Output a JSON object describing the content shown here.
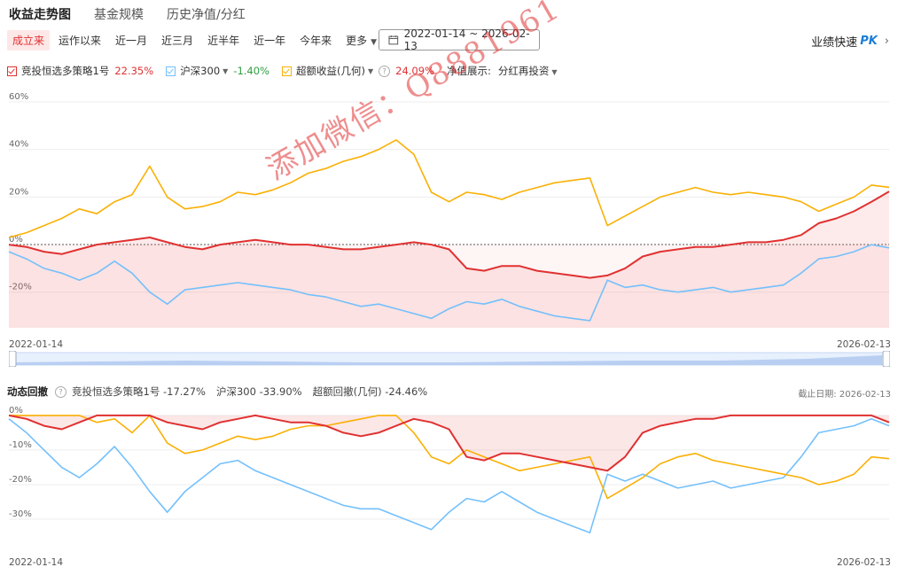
{
  "tabs": [
    "收益走势图",
    "基金规模",
    "历史净值/分红"
  ],
  "periods": [
    "成立来",
    "运作以来",
    "近一月",
    "近三月",
    "近半年",
    "近一年",
    "今年来"
  ],
  "more_label": "更多",
  "date_range": "2022-01-14 ~ 2026-02-13",
  "pk_label": "业绩快速",
  "pk_badge": "PK",
  "legend": {
    "fund": {
      "name": "竞投恒选多策略1号",
      "value": "22.35%"
    },
    "index": {
      "name": "沪深300",
      "value": "-1.40%"
    },
    "excess": {
      "name": "超额收益(几何)",
      "value": "24.09%"
    },
    "nav_label": "净值展示:",
    "nav_mode": "分红再投资"
  },
  "watermark": "添加微信：Q8881961",
  "drawdown_header": {
    "title": "动态回撤",
    "fund": "竞投恒选多策略1号",
    "fund_value": "-17.27%",
    "index": "沪深300",
    "index_value": "-33.90%",
    "excess": "超额回撤(几何)",
    "excess_value": "-24.46%",
    "as_of_label": "截止日期:",
    "as_of": "2026-02-13"
  },
  "colors": {
    "fund": "#e03131",
    "index": "#74c0fc",
    "excess": "#fab005",
    "active": "#e03131"
  },
  "chart_data": [
    {
      "type": "line",
      "x_start": "2022-01-14",
      "x_end": "2026-02-13",
      "ylim": [
        -35,
        60
      ],
      "y_ticks": [
        "60%",
        "40%",
        "20%",
        "0%",
        "-20%"
      ],
      "y_tick_values": [
        60,
        40,
        20,
        0,
        -20
      ],
      "x": [
        0,
        2,
        4,
        6,
        8,
        10,
        12,
        14,
        16,
        18,
        20,
        22,
        24,
        26,
        28,
        30,
        32,
        34,
        36,
        38,
        40,
        42,
        44,
        46,
        48,
        50,
        52,
        54,
        56,
        58,
        60,
        62,
        64,
        66,
        68,
        70,
        72,
        74,
        76,
        78,
        80,
        82,
        84,
        86,
        88,
        90,
        92,
        94,
        96,
        98,
        100
      ],
      "series": [
        {
          "name": "竞投恒选多策略1号",
          "values": [
            0,
            -1,
            -3,
            -4,
            -2,
            0,
            1,
            2,
            3,
            1,
            -1,
            -2,
            0,
            1,
            2,
            1,
            0,
            0,
            -1,
            -2,
            -2,
            -1,
            0,
            1,
            0,
            -2,
            -10,
            -11,
            -9,
            -9,
            -11,
            -12,
            -13,
            -14,
            -13,
            -10,
            -5,
            -3,
            -2,
            -1,
            -1,
            0,
            1,
            1,
            2,
            4,
            9,
            11,
            14,
            18,
            22.35
          ]
        },
        {
          "name": "沪深300",
          "values": [
            -3,
            -6,
            -10,
            -12,
            -15,
            -12,
            -7,
            -12,
            -20,
            -25,
            -19,
            -18,
            -17,
            -16,
            -17,
            -18,
            -19,
            -21,
            -22,
            -24,
            -26,
            -25,
            -27,
            -29,
            -31,
            -27,
            -24,
            -25,
            -23,
            -26,
            -28,
            -30,
            -31,
            -32,
            -15,
            -18,
            -17,
            -19,
            -20,
            -19,
            -18,
            -20,
            -19,
            -18,
            -17,
            -12,
            -6,
            -5,
            -3,
            0,
            -1.4
          ]
        },
        {
          "name": "超额收益(几何)",
          "values": [
            3,
            5,
            8,
            11,
            15,
            13,
            18,
            21,
            33,
            20,
            15,
            16,
            18,
            22,
            21,
            23,
            26,
            30,
            32,
            35,
            37,
            40,
            44,
            38,
            22,
            18,
            22,
            21,
            19,
            22,
            24,
            26,
            27,
            28,
            8,
            12,
            16,
            20,
            22,
            24,
            22,
            21,
            22,
            21,
            20,
            18,
            14,
            17,
            20,
            25,
            24.09
          ]
        }
      ]
    },
    {
      "type": "line",
      "x_start": "2022-01-14",
      "x_end": "2026-02-13",
      "ylim": [
        -40,
        1
      ],
      "y_ticks": [
        "0%",
        "-10%",
        "-20%",
        "-30%"
      ],
      "y_tick_values": [
        0,
        -10,
        -20,
        -30
      ],
      "x": [
        0,
        2,
        4,
        6,
        8,
        10,
        12,
        14,
        16,
        18,
        20,
        22,
        24,
        26,
        28,
        30,
        32,
        34,
        36,
        38,
        40,
        42,
        44,
        46,
        48,
        50,
        52,
        54,
        56,
        58,
        60,
        62,
        64,
        66,
        68,
        70,
        72,
        74,
        76,
        78,
        80,
        82,
        84,
        86,
        88,
        90,
        92,
        94,
        96,
        98,
        100
      ],
      "series": [
        {
          "name": "竞投恒选多策略1号",
          "values": [
            0,
            -1,
            -3,
            -4,
            -2,
            0,
            0,
            0,
            0,
            -2,
            -3,
            -4,
            -2,
            -1,
            0,
            -1,
            -2,
            -2,
            -3,
            -5,
            -6,
            -5,
            -3,
            -1,
            -2,
            -4,
            -12,
            -13,
            -11,
            -11,
            -12,
            -13,
            -14,
            -15,
            -16,
            -12,
            -5,
            -3,
            -2,
            -1,
            -1,
            0,
            0,
            0,
            0,
            0,
            0,
            0,
            0,
            0,
            -2
          ]
        },
        {
          "name": "沪深300",
          "values": [
            -1,
            -5,
            -10,
            -15,
            -18,
            -14,
            -9,
            -15,
            -22,
            -28,
            -22,
            -18,
            -14,
            -13,
            -16,
            -18,
            -20,
            -22,
            -24,
            -26,
            -27,
            -27,
            -29,
            -31,
            -33,
            -28,
            -24,
            -25,
            -22,
            -25,
            -28,
            -30,
            -32,
            -33.9,
            -17,
            -19,
            -17,
            -19,
            -21,
            -20,
            -19,
            -21,
            -20,
            -19,
            -18,
            -12,
            -5,
            -4,
            -3,
            -1,
            -3
          ]
        },
        {
          "name": "超额回撤(几何)",
          "values": [
            0,
            0,
            0,
            0,
            0,
            -2,
            -1,
            -5,
            0,
            -8,
            -11,
            -10,
            -8,
            -6,
            -7,
            -6,
            -4,
            -3,
            -3,
            -2,
            -1,
            0,
            0,
            -5,
            -12,
            -14,
            -10,
            -12,
            -14,
            -16,
            -15,
            -14,
            -13,
            -12,
            -24,
            -21,
            -18,
            -14,
            -12,
            -11,
            -13,
            -14,
            -15,
            -16,
            -17,
            -18,
            -20,
            -19,
            -17,
            -12,
            -12.5
          ]
        }
      ]
    }
  ]
}
